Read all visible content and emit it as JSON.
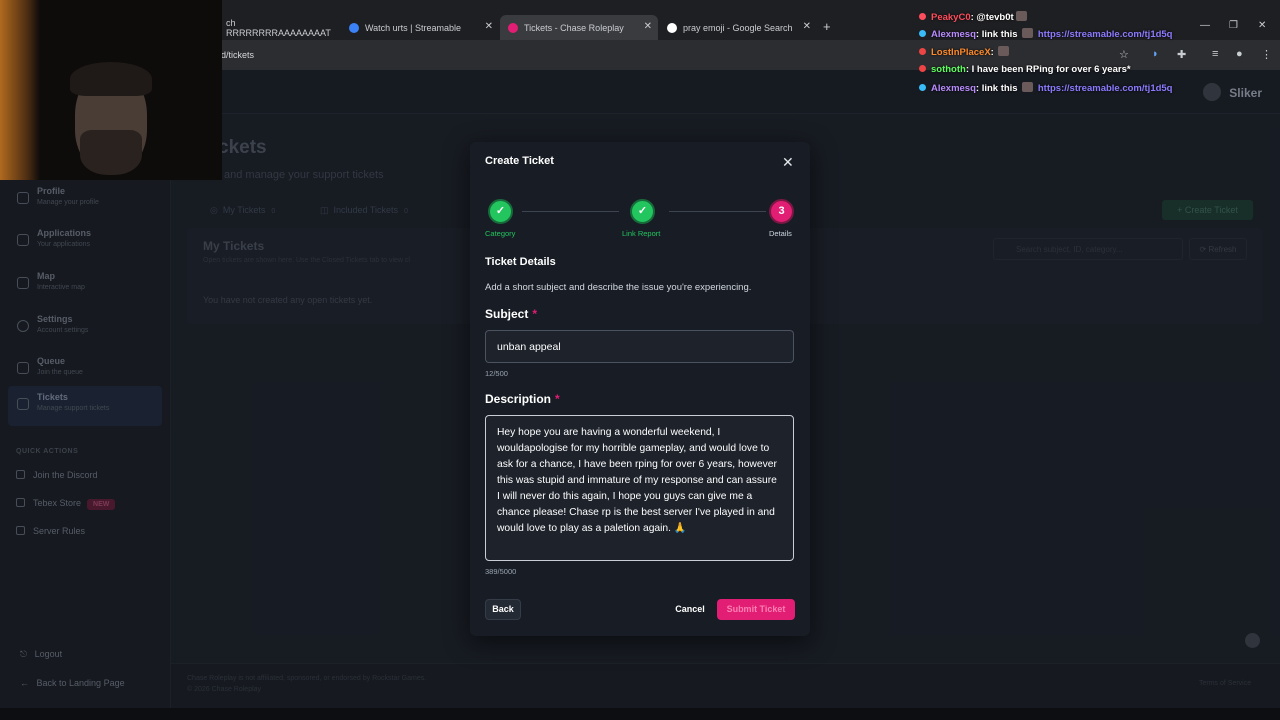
{
  "browser": {
    "tabs": [
      {
        "label": "ch RRRRRRRRAAAAAAAAT"
      },
      {
        "label": "Watch urts | Streamable"
      },
      {
        "label": "Tickets - Chase Roleplay"
      },
      {
        "label": "pray emoji - Google Search"
      }
    ],
    "url": "rd/tickets"
  },
  "header": {
    "brand": "Sliker"
  },
  "sidebar": {
    "items": [
      {
        "label": "Profile",
        "sub": "Manage your profile"
      },
      {
        "label": "Applications",
        "sub": "Your applications"
      },
      {
        "label": "Map",
        "sub": "Interactive map"
      },
      {
        "label": "Settings",
        "sub": "Account settings"
      },
      {
        "label": "Queue",
        "sub": "Join the queue"
      },
      {
        "label": "Tickets",
        "sub": "Manage support tickets"
      }
    ],
    "quick_actions_title": "QUICK ACTIONS",
    "quick_actions": [
      {
        "label": "Join the Discord"
      },
      {
        "label": "Tebex Store",
        "badge": "NEW"
      },
      {
        "label": "Server Rules"
      }
    ],
    "logout": "Logout",
    "back_link": "Back to Landing Page"
  },
  "main": {
    "title": "ckets",
    "subtitle": "and manage your support tickets",
    "tabs": [
      {
        "label": "My Tickets",
        "count": "0"
      },
      {
        "label": "Included Tickets",
        "count": "0"
      }
    ],
    "create_button": "+ Create Ticket",
    "panel_title": "My Tickets",
    "panel_hint": "Open tickets are shown here. Use the Closed Tickets tab to view cl",
    "empty_text": "You have not created any open tickets yet.",
    "search_placeholder": "Search subject, ID, category...",
    "refresh": "Refresh",
    "footer_line1": "Chase Roleplay is not affiliated, sponsored, or endorsed by Rockstar Games.",
    "footer_line2": "© 2026 Chase Roleplay",
    "footer_right": "Terms of Service"
  },
  "modal": {
    "title": "Create Ticket",
    "steps": [
      {
        "label": "Category",
        "state": "done",
        "marker": "✓"
      },
      {
        "label": "Link Report",
        "state": "done",
        "marker": "✓"
      },
      {
        "label": "Details",
        "state": "current",
        "marker": "3"
      }
    ],
    "section_title": "Ticket Details",
    "section_desc": "Add a short subject and describe the issue you're experiencing.",
    "subject_label": "Subject",
    "required_mark": "*",
    "subject_value": "unban appeal",
    "subject_count": "12/500",
    "description_label": "Description",
    "description_value": "Hey hope you are having a wonderful weekend, I wouldapologise for my horrible gameplay, and would love to ask for a chance, I have been rping for over 6 years, however this was stupid and immature of my response and can assure I will never do this again, I hope you guys can give me a chance please! Chase rp is the best server I've played in and would love to play as a paletion again. 🙏",
    "description_count": "389/5000",
    "back_button": "Back",
    "cancel_button": "Cancel",
    "submit_button": "Submit Ticket"
  },
  "chat": [
    {
      "user": "PeakyC0",
      "msg": ": @tevb0t",
      "color": "#ff4d5e",
      "link": ""
    },
    {
      "user": "Alexmesq",
      "msg": ": link this",
      "color": "#b98cff",
      "link": "https://streamable.com/tj1d5q"
    },
    {
      "user": "LostInPlaceX",
      "msg": ":",
      "color": "#ff8a2a",
      "link": ""
    },
    {
      "user": "sothoth",
      "msg": ": I have been RPing for over 6 years*",
      "color": "#5dff5d",
      "link": ""
    },
    {
      "user": "Alexmesq",
      "msg": ": link this",
      "color": "#b98cff",
      "link": "https://streamable.com/tj1d5q"
    }
  ],
  "colors": {
    "accent": "#e11d74",
    "success": "#22c55e",
    "modal_bg": "#181d25"
  }
}
